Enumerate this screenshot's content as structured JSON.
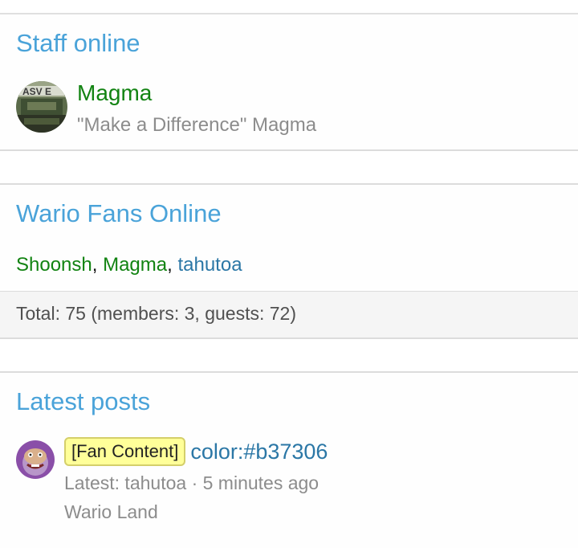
{
  "staff_online": {
    "title": "Staff online",
    "user": {
      "name": "Magma",
      "user_title": "\"Make a Difference\" Magma"
    }
  },
  "fans_online": {
    "title": "Wario Fans Online",
    "users": [
      {
        "name": "Shoonsh",
        "role": "staff"
      },
      {
        "name": "Magma",
        "role": "staff"
      },
      {
        "name": "tahutoa",
        "role": "member"
      }
    ],
    "separator": ", ",
    "total_text": "Total: 75 (members: 3, guests: 72)"
  },
  "latest_posts": {
    "title": "Latest posts",
    "post": {
      "prefix": "[Fan Content]",
      "title": "color:#b37306",
      "meta": "Latest: tahutoa · 5 minutes ago",
      "forum": "Wario Land"
    }
  },
  "colors": {
    "block_title": "#4aa3d9",
    "staff_name": "#128312",
    "member_name": "#2b77a6",
    "muted": "#8c8c8c",
    "prefix_bg": "#ffff99"
  }
}
